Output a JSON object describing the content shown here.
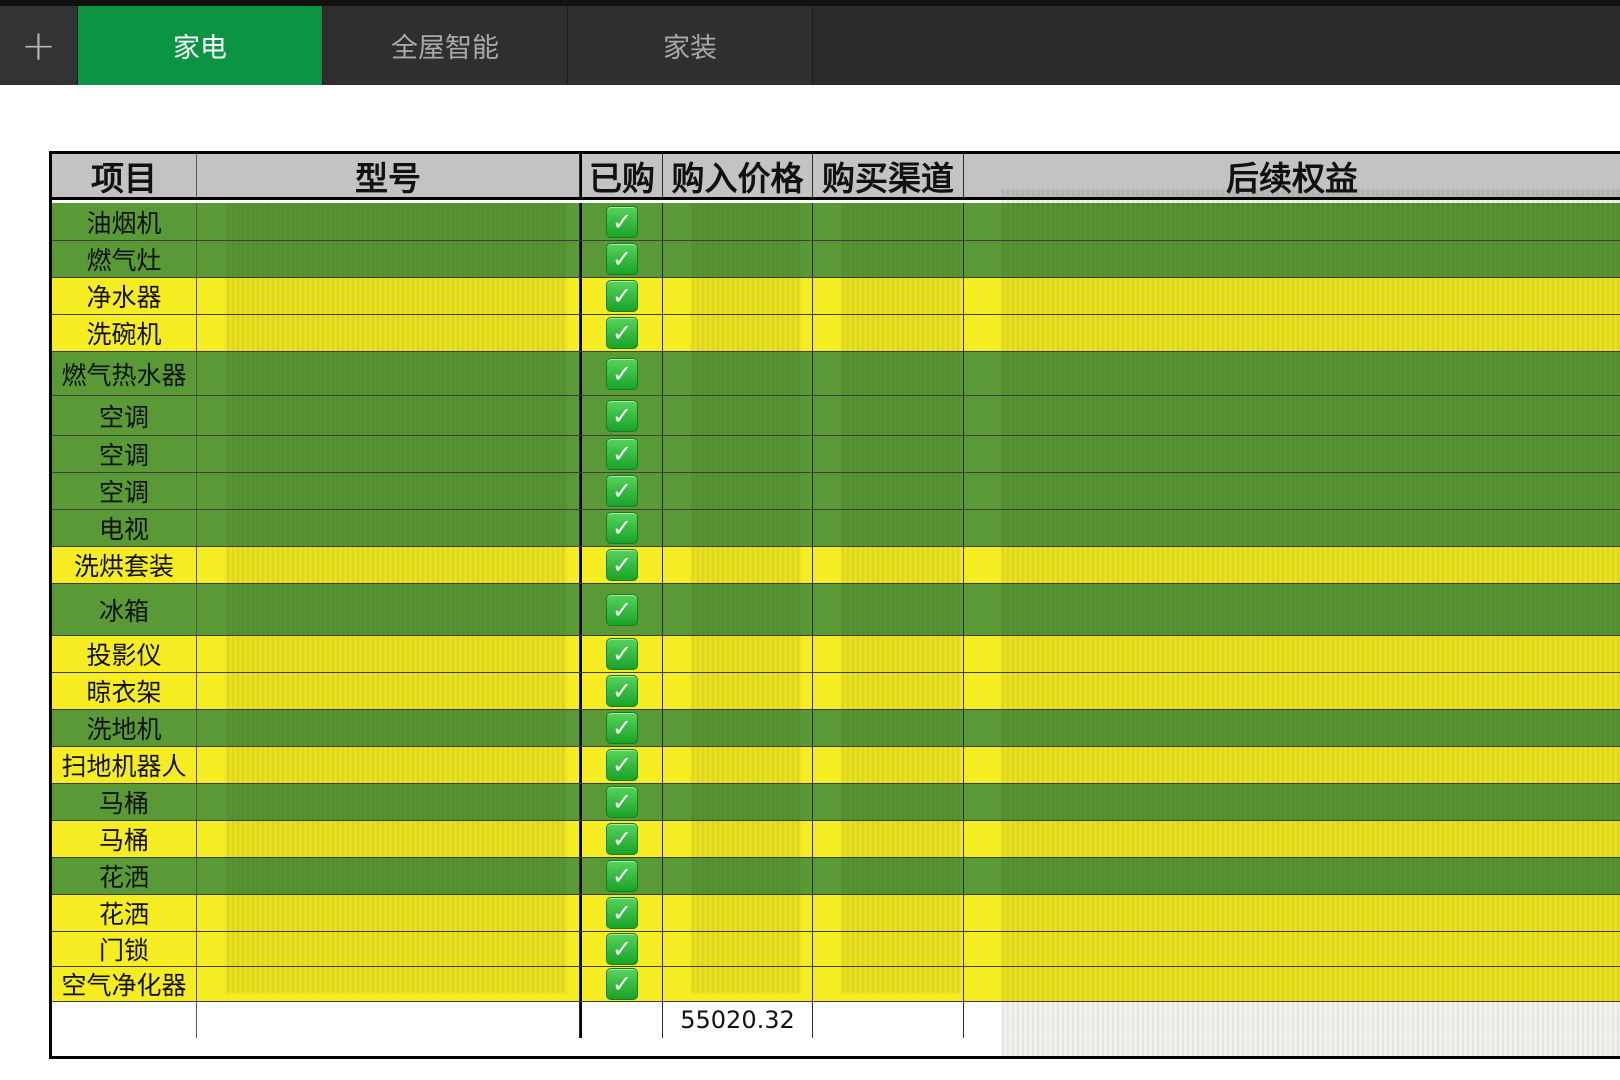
{
  "tabs": {
    "add_label": "+",
    "items": [
      {
        "label": "家电"
      },
      {
        "label": "全屋智能"
      },
      {
        "label": "家装"
      }
    ]
  },
  "table": {
    "headers": {
      "item": "项目",
      "model": "型号",
      "bought": "已购",
      "price": "购入价格",
      "channel": "购买渠道",
      "rights": "后续权益"
    },
    "rows": [
      {
        "item": "油烟机",
        "color": "green",
        "checked": true
      },
      {
        "item": "燃气灶",
        "color": "green",
        "checked": true
      },
      {
        "item": "净水器",
        "color": "yellow",
        "checked": true
      },
      {
        "item": "洗碗机",
        "color": "yellow",
        "checked": true
      },
      {
        "item": "燃气热水器",
        "color": "green",
        "checked": true
      },
      {
        "item": "空调",
        "color": "green",
        "checked": true
      },
      {
        "item": "空调",
        "color": "green",
        "checked": true
      },
      {
        "item": "空调",
        "color": "green",
        "checked": true
      },
      {
        "item": "电视",
        "color": "green",
        "checked": true
      },
      {
        "item": "洗烘套装",
        "color": "yellow",
        "checked": true
      },
      {
        "item": "冰箱",
        "color": "green",
        "checked": true
      },
      {
        "item": "投影仪",
        "color": "yellow",
        "checked": true
      },
      {
        "item": "晾衣架",
        "color": "yellow",
        "checked": true
      },
      {
        "item": "洗地机",
        "color": "green",
        "checked": true
      },
      {
        "item": "扫地机器人",
        "color": "yellow",
        "checked": true
      },
      {
        "item": "马桶",
        "color": "green",
        "checked": true
      },
      {
        "item": "马桶",
        "color": "yellow",
        "checked": true
      },
      {
        "item": "花洒",
        "color": "green",
        "checked": true
      },
      {
        "item": "花洒",
        "color": "yellow",
        "checked": true
      },
      {
        "item": "门锁",
        "color": "yellow",
        "checked": true
      },
      {
        "item": "空气净化器",
        "color": "yellow",
        "checked": true
      }
    ],
    "total_price": "55020.32"
  },
  "colors": {
    "active_tab": "#0b9444",
    "row_green": "#5a9a36",
    "row_yellow": "#f6ec22",
    "header_gray": "#c3c3c3"
  },
  "icons": {
    "add": "plus-icon",
    "check": "checkbox-checked-icon"
  }
}
